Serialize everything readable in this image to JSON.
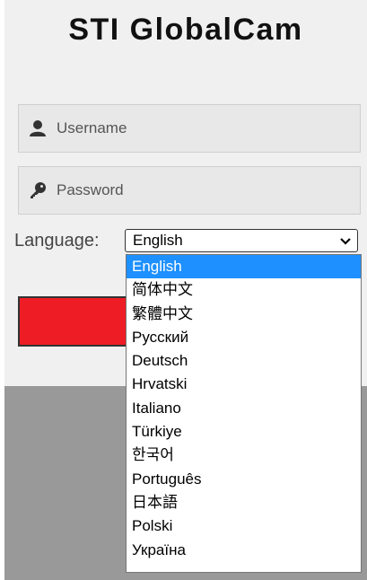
{
  "app": {
    "title": "STI GlobalCam"
  },
  "login": {
    "username_placeholder": "Username",
    "password_placeholder": "Password",
    "language_label": "Language:",
    "language_selected": "English",
    "button_color": "#ee1c25"
  },
  "icons": {
    "username": "user-icon",
    "password": "key-icon",
    "select": "chevron-down-icon"
  },
  "languages": [
    "English",
    "简体中文",
    "繁體中文",
    "Русский",
    "Deutsch",
    "Hrvatski",
    "Italiano",
    "Türkiye",
    "한국어",
    "Português",
    "日本語",
    "Polski",
    "Україна"
  ],
  "colors": {
    "highlight": "#1e90ff",
    "accent": "#ee1c25"
  }
}
